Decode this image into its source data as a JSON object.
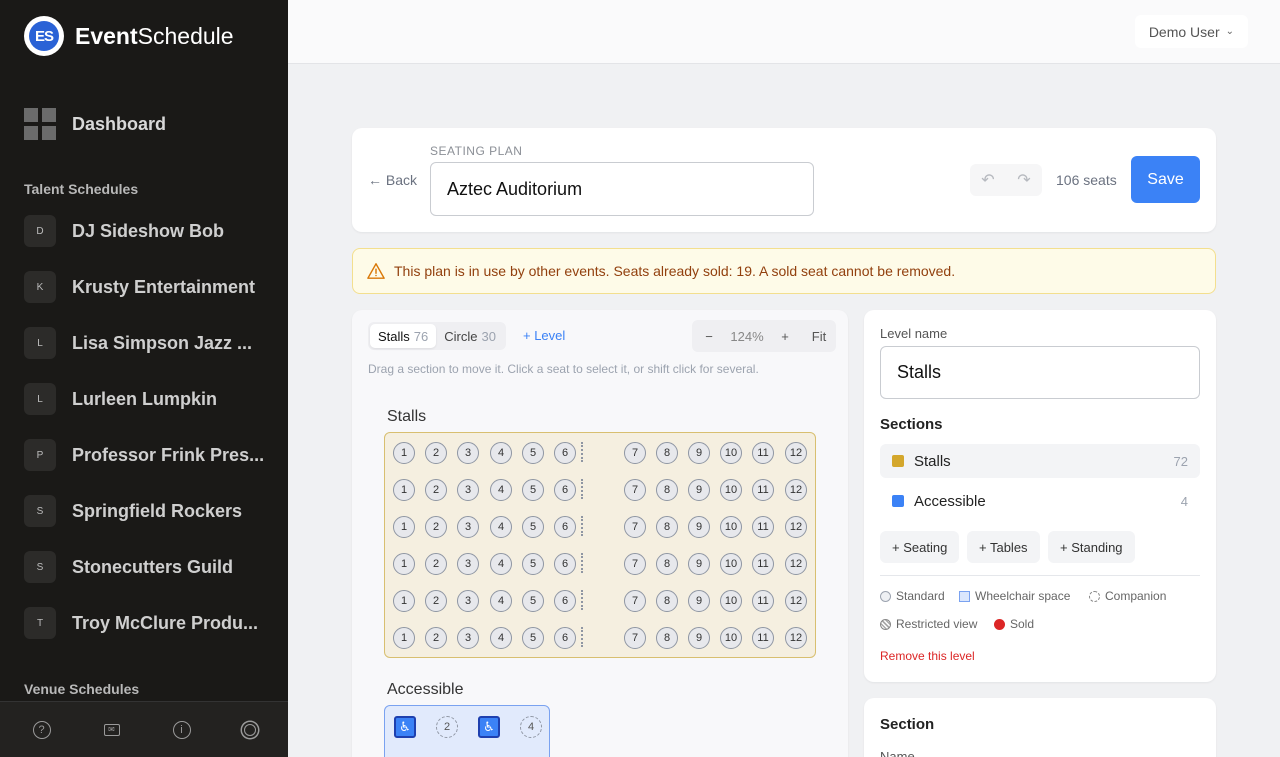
{
  "brand": {
    "logo_text": "ES",
    "name_bold": "Event",
    "name_rest": "Schedule"
  },
  "sidebar": {
    "dashboard_label": "Dashboard",
    "talent_heading": "Talent Schedules",
    "venue_heading": "Venue Schedules",
    "items": [
      {
        "initial": "D",
        "label": "DJ Sideshow Bob"
      },
      {
        "initial": "K",
        "label": "Krusty Entertainment"
      },
      {
        "initial": "L",
        "label": "Lisa Simpson Jazz ..."
      },
      {
        "initial": "L",
        "label": "Lurleen Lumpkin"
      },
      {
        "initial": "P",
        "label": "Professor Frink Pres..."
      },
      {
        "initial": "S",
        "label": "Springfield Rockers"
      },
      {
        "initial": "S",
        "label": "Stonecutters Guild"
      },
      {
        "initial": "T",
        "label": "Troy McClure Produ..."
      }
    ],
    "footer_icons": [
      "help-icon",
      "mail-icon",
      "info-icon",
      "theme-icon"
    ]
  },
  "topbar": {
    "user_label": "Demo User"
  },
  "header": {
    "back_label": "Back",
    "plan_label": "SEATING PLAN",
    "plan_name": "Aztec Auditorium",
    "seat_count": "106 seats",
    "save_label": "Save"
  },
  "warning": {
    "text": "This plan is in use by other events. Seats already sold: 19. A sold seat cannot be removed."
  },
  "canvas": {
    "tabs": [
      {
        "label": "Stalls",
        "count": "76"
      },
      {
        "label": "Circle",
        "count": "30"
      }
    ],
    "add_level": "+ Level",
    "zoom_minus": "−",
    "zoom": "124%",
    "zoom_plus": "+",
    "zoom_fit": "Fit",
    "hint": "Drag a section to move it. Click a seat to select it, or shift click for several.",
    "stalls_title": "Stalls",
    "accessible_title": "Accessible",
    "seat_numbers": [
      "1",
      "2",
      "3",
      "4",
      "5",
      "6",
      "7",
      "8",
      "9",
      "10",
      "11",
      "12"
    ],
    "accessible_seats": [
      {
        "type": "wheelchair",
        "label": "♿"
      },
      {
        "type": "companion",
        "label": "2"
      },
      {
        "type": "wheelchair",
        "label": "♿"
      },
      {
        "type": "companion",
        "label": "4"
      }
    ]
  },
  "level_panel": {
    "level_name_label": "Level name",
    "level_name": "Stalls",
    "sections_heading": "Sections",
    "sections": [
      {
        "name": "Stalls",
        "count": "72",
        "color": "#d4a72c"
      },
      {
        "name": "Accessible",
        "count": "4",
        "color": "#3b82f6"
      }
    ],
    "add_seating": "+ Seating",
    "add_tables": "+ Tables",
    "add_standing": "+ Standing",
    "legend": {
      "standard": "Standard",
      "wheelchair": "Wheelchair space",
      "companion": "Companion",
      "restricted": "Restricted view",
      "sold": "Sold"
    },
    "remove_level": "Remove this level"
  },
  "section_panel": {
    "heading": "Section",
    "name_label": "Name"
  }
}
